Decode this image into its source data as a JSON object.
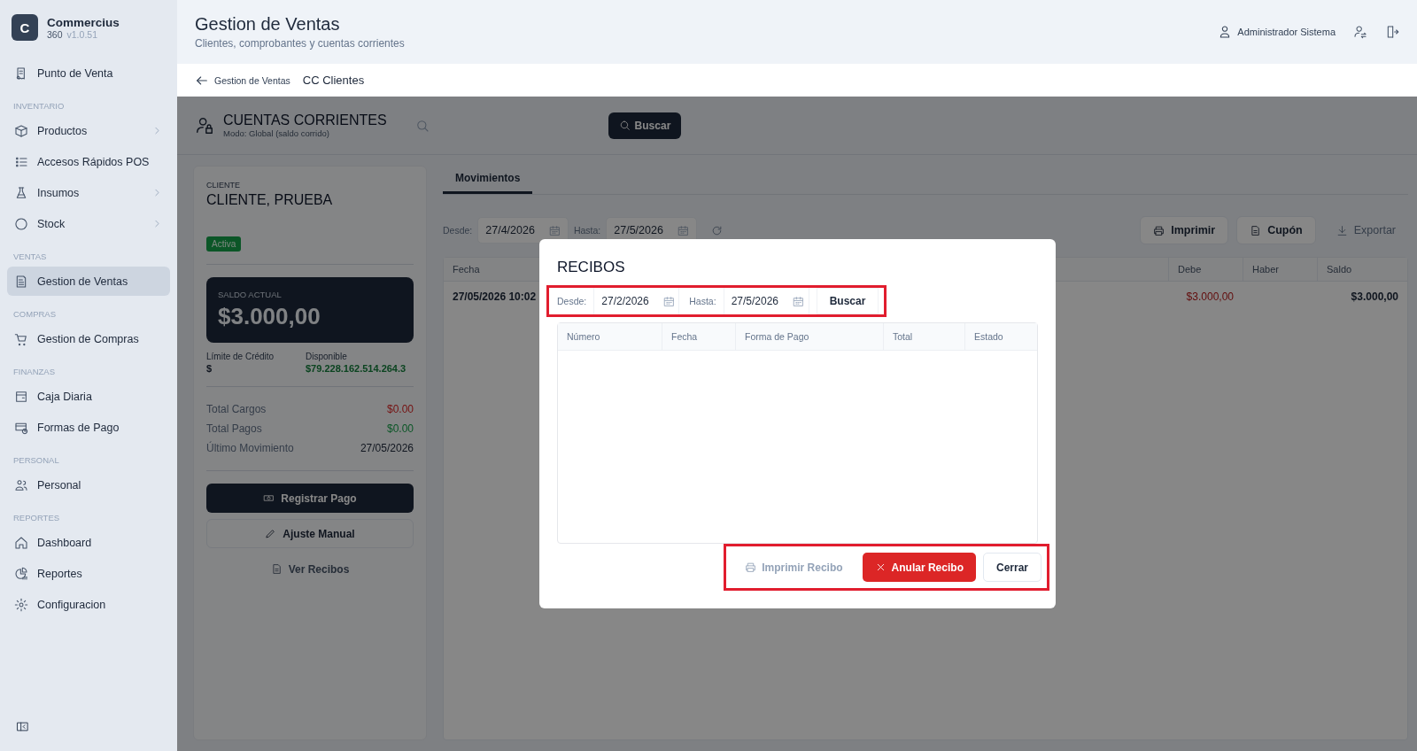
{
  "brand": {
    "initial": "C",
    "name": "Commercius",
    "edition": "360",
    "version": "v1.0.51"
  },
  "sidebar": {
    "groups": [
      {
        "items": [
          {
            "label": "Punto de Venta",
            "selected": false,
            "expandable": false
          }
        ]
      },
      {
        "heading": "INVENTARIO",
        "items": [
          {
            "label": "Productos",
            "selected": false,
            "expandable": true
          },
          {
            "label": "Accesos Rápidos POS",
            "selected": false,
            "expandable": false
          },
          {
            "label": "Insumos",
            "selected": false,
            "expandable": true
          },
          {
            "label": "Stock",
            "selected": false,
            "expandable": true
          }
        ]
      },
      {
        "heading": "VENTAS",
        "items": [
          {
            "label": "Gestion de Ventas",
            "selected": true,
            "expandable": false
          }
        ]
      },
      {
        "heading": "COMPRAS",
        "items": [
          {
            "label": "Gestion de Compras",
            "selected": false,
            "expandable": false
          }
        ]
      },
      {
        "heading": "FINANZAS",
        "items": [
          {
            "label": "Caja Diaria",
            "selected": false,
            "expandable": false
          },
          {
            "label": "Formas de Pago",
            "selected": false,
            "expandable": false
          }
        ]
      },
      {
        "heading": "PERSONAL",
        "items": [
          {
            "label": "Personal",
            "selected": false,
            "expandable": false
          }
        ]
      },
      {
        "heading": "REPORTES",
        "items": [
          {
            "label": "Dashboard",
            "selected": false,
            "expandable": false
          },
          {
            "label": "Reportes",
            "selected": false,
            "expandable": false
          },
          {
            "label": "Configuracion",
            "selected": false,
            "expandable": false
          }
        ]
      }
    ]
  },
  "header": {
    "title": "Gestion de Ventas",
    "subtitle": "Clientes, comprobantes y cuentas corrientes",
    "user": "Administrador Sistema"
  },
  "breadcrumb": {
    "back": "Gestion de Ventas",
    "current": "CC Clientes"
  },
  "toolbar": {
    "title": "CUENTAS CORRIENTES",
    "mode": "Modo: Global (saldo corrido)",
    "search_button": "Buscar"
  },
  "client": {
    "label": "CLIENTE",
    "name": "CLIENTE, PRUEBA",
    "status": "Activa",
    "balance_label": "SALDO ACTUAL",
    "balance": "$3.000,00",
    "credit_label": "Límite de Crédito",
    "credit": "$",
    "available_label": "Disponible",
    "available": "$79.228.162.514.264.3",
    "totals": [
      {
        "label": "Total Cargos",
        "value": "$0.00",
        "kind": "debit"
      },
      {
        "label": "Total Pagos",
        "value": "$0.00",
        "kind": "credit"
      },
      {
        "label": "Último Movimiento",
        "value": "27/05/2026",
        "kind": "date"
      }
    ],
    "actions": [
      {
        "label": "Registrar Pago",
        "kind": "primary"
      },
      {
        "label": "Ajuste Manual",
        "kind": "outline"
      },
      {
        "label": "Ver Recibos",
        "kind": "link"
      }
    ]
  },
  "movements": {
    "tabs": [
      {
        "label": "Movimientos",
        "selected": true
      }
    ],
    "from_label": "Desde:",
    "from": "27/4/2026",
    "to_label": "Hasta:",
    "to": "27/5/2026",
    "actions": [
      {
        "label": "Imprimir",
        "kind": "outline"
      },
      {
        "label": "Cupón",
        "kind": "outline"
      },
      {
        "label": "Exportar",
        "kind": "plain"
      }
    ],
    "columns": [
      "Fecha",
      "Debe",
      "Haber",
      "Saldo"
    ],
    "rows": [
      {
        "fecha": "27/05/2026 10:02",
        "debe": "$3.000,00",
        "saldo": "$3.000,00"
      }
    ]
  },
  "modal": {
    "title": "RECIBOS",
    "filters": {
      "highlighted": true,
      "from_label": "Desde:",
      "from": "27/2/2026",
      "to_label": "Hasta:",
      "to": "27/5/2026",
      "button": "Buscar"
    },
    "columns": [
      "Número",
      "Fecha",
      "Forma de Pago",
      "Total",
      "Estado"
    ],
    "footer": {
      "highlighted": true,
      "buttons": [
        {
          "label": "Imprimir Recibo",
          "kind": "ghost",
          "disabled": true
        },
        {
          "label": "Anular Recibo",
          "kind": "danger",
          "disabled": false
        },
        {
          "label": "Cerrar",
          "kind": "outline",
          "disabled": false
        }
      ]
    }
  }
}
